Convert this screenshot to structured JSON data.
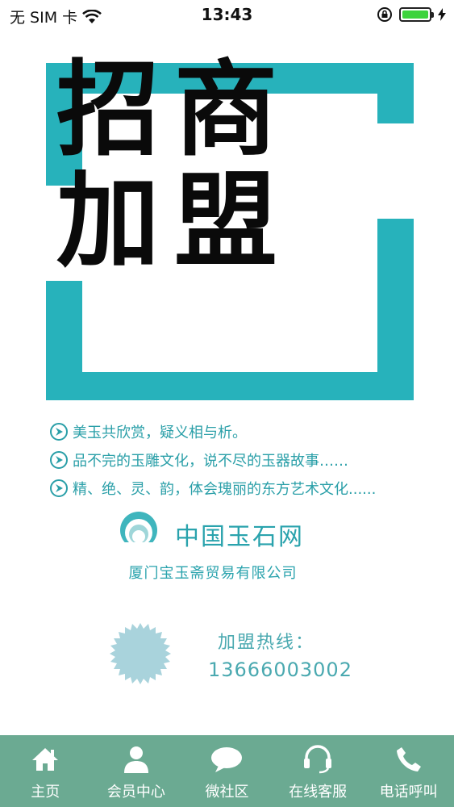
{
  "status_bar": {
    "carrier": "无 SIM 卡",
    "time": "13:43"
  },
  "hero": {
    "title_line1": "招商",
    "title_line2": "加盟",
    "accent_color": "#27b2bb"
  },
  "taglines": [
    "美玉共欣赏，疑义相与析。",
    "品不完的玉雕文化，说不尽的玉器故事……",
    "精、绝、灵、韵，体会瑰丽的东方艺术文化......"
  ],
  "brand": {
    "name": "中国玉石网",
    "company": "厦门宝玉斋贸易有限公司"
  },
  "hotline": {
    "label": "加盟热线：",
    "number": "13666003002"
  },
  "tabbar": {
    "background": "#6baa92",
    "items": [
      {
        "label": "主页",
        "icon": "home-icon"
      },
      {
        "label": "会员中心",
        "icon": "user-icon"
      },
      {
        "label": "微社区",
        "icon": "chat-bubble-icon"
      },
      {
        "label": "在线客服",
        "icon": "headset-icon"
      },
      {
        "label": "电话呼叫",
        "icon": "phone-icon"
      }
    ]
  }
}
